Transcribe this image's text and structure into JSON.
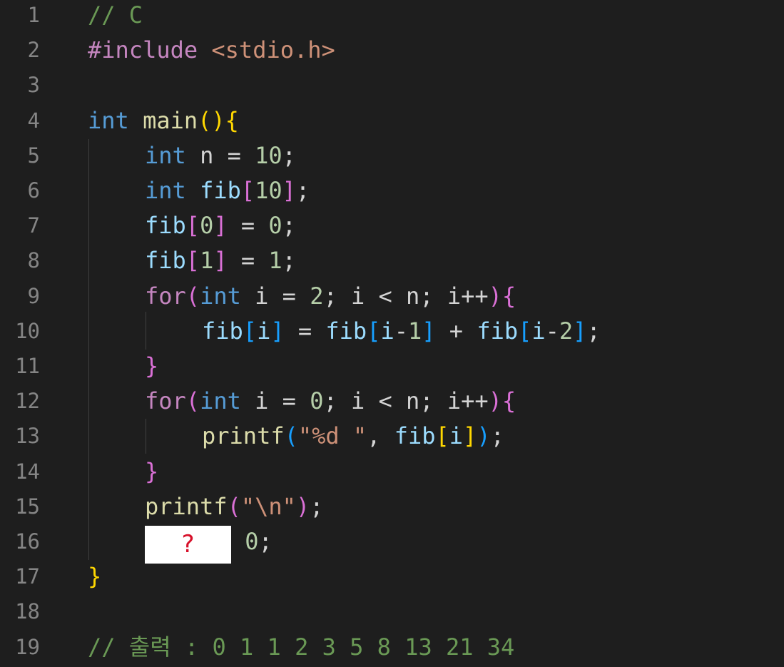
{
  "editor": {
    "lines": [
      {
        "num": "1",
        "indent": 0,
        "tokens": [
          {
            "t": "// C",
            "c": "#6a9955"
          }
        ]
      },
      {
        "num": "2",
        "indent": 0,
        "tokens": [
          {
            "t": "#include",
            "c": "#c586c0"
          },
          {
            "t": " ",
            "c": "#d4d4d4"
          },
          {
            "t": "<stdio.h>",
            "c": "#ce9178"
          }
        ]
      },
      {
        "num": "3",
        "indent": 0,
        "tokens": []
      },
      {
        "num": "4",
        "indent": 0,
        "tokens": [
          {
            "t": "int",
            "c": "#569cd6"
          },
          {
            "t": " ",
            "c": "#d4d4d4"
          },
          {
            "t": "main",
            "c": "#dcdcaa"
          },
          {
            "t": "(){",
            "c": "#ffd700"
          }
        ]
      },
      {
        "num": "5",
        "indent": 1,
        "tokens": [
          {
            "t": "int",
            "c": "#569cd6"
          },
          {
            "t": " n = ",
            "c": "#d4d4d4"
          },
          {
            "t": "10",
            "c": "#b5cea8"
          },
          {
            "t": ";",
            "c": "#d4d4d4"
          }
        ]
      },
      {
        "num": "6",
        "indent": 1,
        "tokens": [
          {
            "t": "int",
            "c": "#569cd6"
          },
          {
            "t": " ",
            "c": "#d4d4d4"
          },
          {
            "t": "fib",
            "c": "#9cdcfe"
          },
          {
            "t": "[",
            "c": "#da70d6"
          },
          {
            "t": "10",
            "c": "#b5cea8"
          },
          {
            "t": "]",
            "c": "#da70d6"
          },
          {
            "t": ";",
            "c": "#d4d4d4"
          }
        ]
      },
      {
        "num": "7",
        "indent": 1,
        "tokens": [
          {
            "t": "fib",
            "c": "#9cdcfe"
          },
          {
            "t": "[",
            "c": "#da70d6"
          },
          {
            "t": "0",
            "c": "#b5cea8"
          },
          {
            "t": "]",
            "c": "#da70d6"
          },
          {
            "t": " = ",
            "c": "#d4d4d4"
          },
          {
            "t": "0",
            "c": "#b5cea8"
          },
          {
            "t": ";",
            "c": "#d4d4d4"
          }
        ]
      },
      {
        "num": "8",
        "indent": 1,
        "tokens": [
          {
            "t": "fib",
            "c": "#9cdcfe"
          },
          {
            "t": "[",
            "c": "#da70d6"
          },
          {
            "t": "1",
            "c": "#b5cea8"
          },
          {
            "t": "]",
            "c": "#da70d6"
          },
          {
            "t": " = ",
            "c": "#d4d4d4"
          },
          {
            "t": "1",
            "c": "#b5cea8"
          },
          {
            "t": ";",
            "c": "#d4d4d4"
          }
        ]
      },
      {
        "num": "9",
        "indent": 1,
        "tokens": [
          {
            "t": "for",
            "c": "#c586c0"
          },
          {
            "t": "(",
            "c": "#da70d6"
          },
          {
            "t": "int",
            "c": "#569cd6"
          },
          {
            "t": " i = ",
            "c": "#d4d4d4"
          },
          {
            "t": "2",
            "c": "#b5cea8"
          },
          {
            "t": "; i < n; i++",
            "c": "#d4d4d4"
          },
          {
            "t": "){",
            "c": "#da70d6"
          }
        ]
      },
      {
        "num": "10",
        "indent": 2,
        "tokens": [
          {
            "t": "fib",
            "c": "#9cdcfe"
          },
          {
            "t": "[",
            "c": "#179fff"
          },
          {
            "t": "i",
            "c": "#9cdcfe"
          },
          {
            "t": "]",
            "c": "#179fff"
          },
          {
            "t": " = ",
            "c": "#d4d4d4"
          },
          {
            "t": "fib",
            "c": "#9cdcfe"
          },
          {
            "t": "[",
            "c": "#179fff"
          },
          {
            "t": "i",
            "c": "#9cdcfe"
          },
          {
            "t": "-",
            "c": "#d4d4d4"
          },
          {
            "t": "1",
            "c": "#b5cea8"
          },
          {
            "t": "]",
            "c": "#179fff"
          },
          {
            "t": " + ",
            "c": "#d4d4d4"
          },
          {
            "t": "fib",
            "c": "#9cdcfe"
          },
          {
            "t": "[",
            "c": "#179fff"
          },
          {
            "t": "i",
            "c": "#9cdcfe"
          },
          {
            "t": "-",
            "c": "#d4d4d4"
          },
          {
            "t": "2",
            "c": "#b5cea8"
          },
          {
            "t": "]",
            "c": "#179fff"
          },
          {
            "t": ";",
            "c": "#d4d4d4"
          }
        ]
      },
      {
        "num": "11",
        "indent": 1,
        "tokens": [
          {
            "t": "}",
            "c": "#da70d6"
          }
        ]
      },
      {
        "num": "12",
        "indent": 1,
        "tokens": [
          {
            "t": "for",
            "c": "#c586c0"
          },
          {
            "t": "(",
            "c": "#da70d6"
          },
          {
            "t": "int",
            "c": "#569cd6"
          },
          {
            "t": " i = ",
            "c": "#d4d4d4"
          },
          {
            "t": "0",
            "c": "#b5cea8"
          },
          {
            "t": "; i < n; i++",
            "c": "#d4d4d4"
          },
          {
            "t": "){",
            "c": "#da70d6"
          }
        ]
      },
      {
        "num": "13",
        "indent": 2,
        "tokens": [
          {
            "t": "printf",
            "c": "#dcdcaa"
          },
          {
            "t": "(",
            "c": "#179fff"
          },
          {
            "t": "\"%d \"",
            "c": "#ce9178"
          },
          {
            "t": ", ",
            "c": "#d4d4d4"
          },
          {
            "t": "fib",
            "c": "#9cdcfe"
          },
          {
            "t": "[",
            "c": "#ffd700"
          },
          {
            "t": "i",
            "c": "#9cdcfe"
          },
          {
            "t": "]",
            "c": "#ffd700"
          },
          {
            "t": ")",
            "c": "#179fff"
          },
          {
            "t": ";",
            "c": "#d4d4d4"
          }
        ]
      },
      {
        "num": "14",
        "indent": 1,
        "tokens": [
          {
            "t": "}",
            "c": "#da70d6"
          }
        ]
      },
      {
        "num": "15",
        "indent": 1,
        "tokens": [
          {
            "t": "printf",
            "c": "#dcdcaa"
          },
          {
            "t": "(",
            "c": "#da70d6"
          },
          {
            "t": "\"\\n\"",
            "c": "#ce9178"
          },
          {
            "t": ")",
            "c": "#da70d6"
          },
          {
            "t": ";",
            "c": "#d4d4d4"
          }
        ]
      },
      {
        "num": "16",
        "indent": 1,
        "tokens": [
          {
            "mask": "?",
            "w": 121
          },
          {
            "t": " ",
            "c": "#d4d4d4"
          },
          {
            "t": "0",
            "c": "#b5cea8"
          },
          {
            "t": ";",
            "c": "#d4d4d4"
          }
        ]
      },
      {
        "num": "17",
        "indent": 0,
        "tokens": [
          {
            "t": "}",
            "c": "#ffd700"
          }
        ]
      },
      {
        "num": "18",
        "indent": 0,
        "tokens": []
      },
      {
        "num": "19",
        "indent": 0,
        "tokens": [
          {
            "t": "// 출력 : 0 1 1 2 3 5 8 13 21 34",
            "c": "#6a9955"
          }
        ]
      }
    ]
  }
}
